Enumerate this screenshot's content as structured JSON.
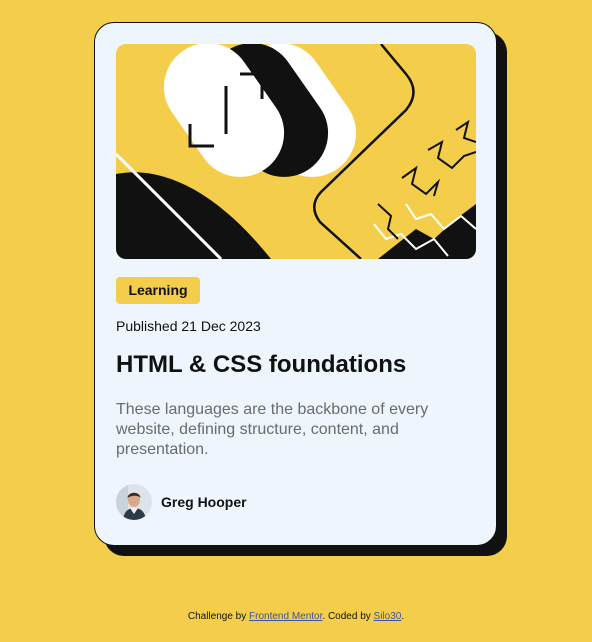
{
  "colors": {
    "background": "#F4CE4B",
    "card": "#EEF5FC",
    "ink": "#111111",
    "muted_text": "#6B6B6B",
    "link": "#3E52A3"
  },
  "card": {
    "hero_image": {
      "icon": "abstract-illustration"
    },
    "tag": "Learning",
    "published": "Published 21 Dec 2023",
    "title": "HTML & CSS foundations",
    "description": "These languages are the backbone of every website, defining structure, content, and presentation.",
    "author": {
      "name": "Greg Hooper",
      "avatar_icon": "person-avatar"
    }
  },
  "footer": {
    "prefix": "Challenge by ",
    "link1": "Frontend Mentor",
    "middle": ". Coded by ",
    "link2": "Silo30",
    "suffix": "."
  }
}
